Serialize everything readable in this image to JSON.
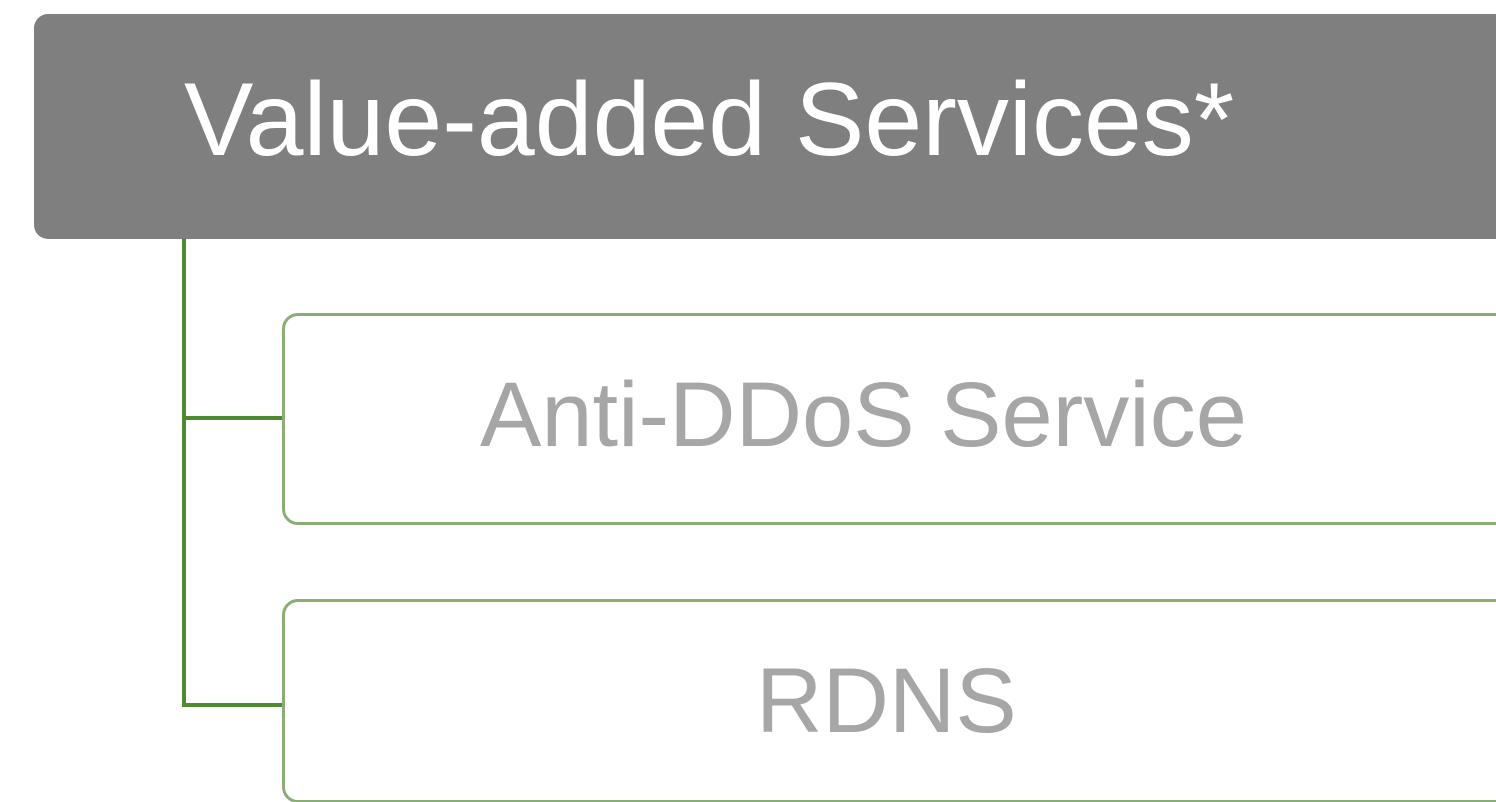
{
  "diagram": {
    "header": {
      "title": "Value-added Services*"
    },
    "children": [
      {
        "label": "Anti-DDoS Service"
      },
      {
        "label": "RDNS"
      }
    ]
  },
  "colors": {
    "header_background": "#7f7f7f",
    "header_text": "#ffffff",
    "connector": "#4e8a2e",
    "child_border": "#8aad74",
    "child_text": "#a6a6a6"
  }
}
